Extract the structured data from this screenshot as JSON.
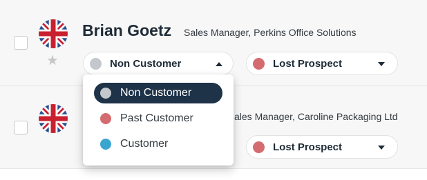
{
  "contacts": [
    {
      "name": "Brian Goetz",
      "subtitle": "Sales Manager, Perkins Office Solutions",
      "flag_icon": "uk-flag-icon",
      "favorite_icon": "star-icon",
      "status_select": {
        "value": "Non Customer",
        "color": "#c4c8cc",
        "open": true
      },
      "stage_select": {
        "value": "Lost Prospect",
        "color": "#d46b6f"
      }
    },
    {
      "name": "",
      "subtitle": "ales Manager, Caroline Packaging Ltd",
      "flag_icon": "uk-flag-icon",
      "stage_select": {
        "value": "Lost Prospect",
        "color": "#d46b6f"
      }
    }
  ],
  "status_dropdown": {
    "options": [
      {
        "label": "Non Customer",
        "color": "#c4c8cc",
        "selected": true
      },
      {
        "label": "Past Customer",
        "color": "#d46b6f",
        "selected": false
      },
      {
        "label": "Customer",
        "color": "#3aa6d0",
        "selected": false
      }
    ]
  },
  "colors": {
    "highlight": "#1e3248",
    "text_dark": "#1e2b36",
    "row_bg": "#f7f7f7"
  }
}
